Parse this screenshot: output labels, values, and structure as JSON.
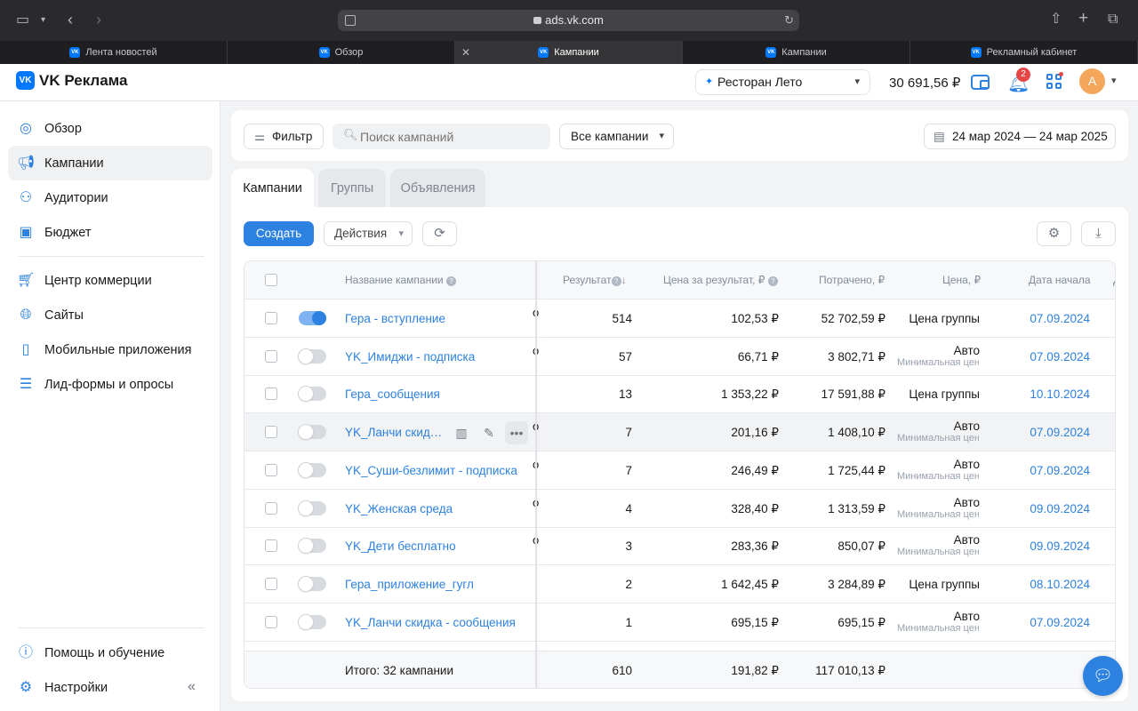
{
  "browser": {
    "url": "ads.vk.com",
    "tabs": [
      {
        "label": "Лента новостей",
        "active": false
      },
      {
        "label": "Обзор",
        "active": false
      },
      {
        "label": "Кампании",
        "active": true
      },
      {
        "label": "Кампании",
        "active": false
      },
      {
        "label": "Рекламный кабинет",
        "active": false
      }
    ]
  },
  "header": {
    "logo": "VK Реклама",
    "account": "Ресторан Лето",
    "balance": "30 691,56 ₽",
    "notifications": "2",
    "avatar": "А"
  },
  "sidebar": {
    "items": [
      {
        "label": "Обзор",
        "icon": "compass-icon"
      },
      {
        "label": "Кампании",
        "icon": "megaphone-icon"
      },
      {
        "label": "Аудитории",
        "icon": "users-icon"
      },
      {
        "label": "Бюджет",
        "icon": "wallet-icon"
      },
      {
        "label": "Центр коммерции",
        "icon": "cart-icon"
      },
      {
        "label": "Сайты",
        "icon": "globe-icon"
      },
      {
        "label": "Мобильные приложения",
        "icon": "smartphone-icon"
      },
      {
        "label": "Лид-формы и опросы",
        "icon": "form-icon"
      }
    ],
    "help": "Помощь и обучение",
    "settings": "Настройки"
  },
  "filters": {
    "filter": "Фильтр",
    "search_placeholder": "Поиск кампаний",
    "scope": "Все кампании",
    "date_range": "24 мар 2024 — 24 мар 2025"
  },
  "section_tabs": [
    "Кампании",
    "Группы",
    "Объявления"
  ],
  "toolbar": {
    "create": "Создать",
    "actions": "Действия"
  },
  "table": {
    "columns": {
      "name": "Название кампании",
      "result": "Результат",
      "cost_per_result": "Цена за результат, ₽",
      "spent": "Потрачено, ₽",
      "price": "Цена, ₽",
      "start": "Дата начала"
    },
    "rows": [
      {
        "on": true,
        "name": "Гера - вступление",
        "frag": "о",
        "result": "514",
        "cpr": "102,53 ₽",
        "spent": "52 702,59 ₽",
        "price": "Цена группы",
        "price_sub": "",
        "start": "07.09.2024"
      },
      {
        "on": false,
        "name": "YK_Имиджи - подписка",
        "frag": "о",
        "result": "57",
        "cpr": "66,71 ₽",
        "spent": "3 802,71 ₽",
        "price": "Авто",
        "price_sub": "Минимальная цена",
        "start": "07.09.2024"
      },
      {
        "on": false,
        "name": "Гера_сообщения",
        "frag": "",
        "result": "13",
        "cpr": "1 353,22 ₽",
        "spent": "17 591,88 ₽",
        "price": "Цена группы",
        "price_sub": "",
        "start": "10.10.2024"
      },
      {
        "on": false,
        "name": "YK_Ланчи скидка - подписка",
        "frag": "о",
        "result": "7",
        "cpr": "201,16 ₽",
        "spent": "1 408,10 ₽",
        "price": "Авто",
        "price_sub": "Минимальная цена",
        "start": "07.09.2024"
      },
      {
        "on": false,
        "name": "YK_Суши-безлимит - подписка",
        "frag": "о",
        "result": "7",
        "cpr": "246,49 ₽",
        "spent": "1 725,44 ₽",
        "price": "Авто",
        "price_sub": "Минимальная цена",
        "start": "07.09.2024"
      },
      {
        "on": false,
        "name": "YK_Женская среда",
        "frag": "о",
        "result": "4",
        "cpr": "328,40 ₽",
        "spent": "1 313,59 ₽",
        "price": "Авто",
        "price_sub": "Минимальная цена",
        "start": "09.09.2024"
      },
      {
        "on": false,
        "name": "YK_Дети бесплатно",
        "frag": "о",
        "result": "3",
        "cpr": "283,36 ₽",
        "spent": "850,07 ₽",
        "price": "Авто",
        "price_sub": "Минимальная цена",
        "start": "09.09.2024"
      },
      {
        "on": false,
        "name": "Гера_приложение_гугл",
        "frag": "",
        "result": "2",
        "cpr": "1 642,45 ₽",
        "spent": "3 284,89 ₽",
        "price": "Цена группы",
        "price_sub": "",
        "start": "08.10.2024"
      },
      {
        "on": false,
        "name": "YK_Ланчи скидка - сообщения",
        "frag": "",
        "result": "1",
        "cpr": "695,15 ₽",
        "spent": "695,15 ₽",
        "price": "Авто",
        "price_sub": "Минимальная цена",
        "start": "07.09.2024"
      }
    ],
    "total": {
      "label": "Итого: 32 кампании",
      "result": "610",
      "cpr": "191,82 ₽",
      "spent": "117 010,13 ₽"
    }
  },
  "colors": {
    "accent": "#2d81e0",
    "vk_blue": "#0077ff",
    "badge": "#e64646"
  }
}
